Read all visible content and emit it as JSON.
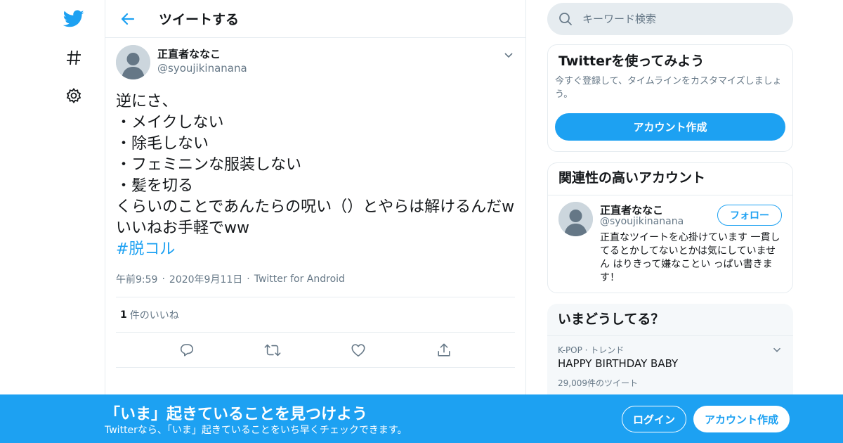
{
  "colors": {
    "brand": "#1da1f2",
    "text_primary": "#14171a",
    "text_secondary": "#657786",
    "border": "#e6ecf0",
    "avatar_bg": "#ccd6dd"
  },
  "leftnav": {
    "icons": [
      "twitter-bird-icon",
      "hashtag-icon",
      "gear-icon"
    ]
  },
  "header": {
    "title": "ツイートする"
  },
  "tweet": {
    "author_name": "正直者ななこ",
    "author_handle": "@syoujikinanana",
    "text": "逆にさ、\n・メイクしない\n・除毛しない\n・フェミニンな服装しない\n・髪を切る\nくらいのことであんたらの呪い（）とやらは解けるんだw\nいいねお手軽でww",
    "hashtag": "#脱コル",
    "time": "午前9:59",
    "date": "2020年9月11日",
    "source": "Twitter for Android",
    "likes_count": "1",
    "likes_label": "件のいいね"
  },
  "search": {
    "placeholder": "キーワード検索"
  },
  "signup_card": {
    "title": "Twitterを使ってみよう",
    "description": "今すぐ登録して、タイムラインをカスタマイズしましょう。",
    "button_label": "アカウント作成"
  },
  "related_card": {
    "title": "関連性の高いアカウント",
    "account_name": "正直者ななこ",
    "account_handle": "@syoujikinanana",
    "follow_label": "フォロー",
    "bio": "正直なツイートを心掛けています 一貫してるとかしてないとかは気にしていません はりきって嫌なことい っぱい書きます！"
  },
  "trends_card": {
    "title": "いまどうしてる？",
    "trend_meta": "K-POP · トレンド",
    "trend_name": "HAPPY BIRTHDAY BABY",
    "trend_count": "29,009件のツイート"
  },
  "bottom_bar": {
    "title": "「いま」起きていることを見つけよう",
    "subtitle": "Twitterなら、「いま」起きていることをいち早くチェックできます。",
    "login_label": "ログイン",
    "signup_label": "アカウント作成"
  }
}
